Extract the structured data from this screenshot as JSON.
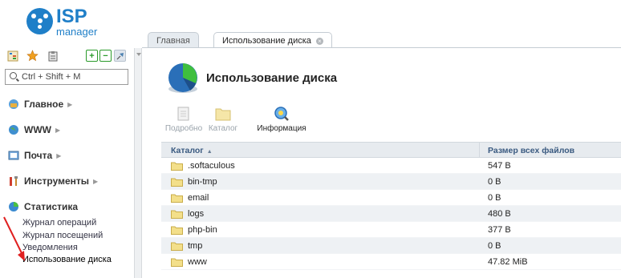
{
  "app": {
    "logo_text": "ISP",
    "logo_sub": "manager"
  },
  "search": {
    "placeholder": "Ctrl + Shift + M"
  },
  "left_toolbar": [
    {
      "icon": "tree-icon"
    },
    {
      "icon": "star-icon"
    },
    {
      "icon": "clipboard-icon"
    },
    {
      "icon": "expand-icon",
      "glyph": "+"
    },
    {
      "icon": "collapse-icon",
      "glyph": "−"
    },
    {
      "icon": "pin-icon"
    }
  ],
  "menu": {
    "groups": [
      {
        "label": "Главное",
        "icon": "home-icon"
      },
      {
        "label": "WWW",
        "icon": "globe-icon"
      },
      {
        "label": "Почта",
        "icon": "mail-icon"
      },
      {
        "label": "Инструменты",
        "icon": "tools-icon"
      },
      {
        "label": "Статистика",
        "icon": "stats-icon"
      }
    ],
    "stats_items": [
      {
        "label": "Журнал операций"
      },
      {
        "label": "Журнал посещений"
      },
      {
        "label": "Уведомления"
      },
      {
        "label": "Использование диска"
      }
    ]
  },
  "tabs": [
    {
      "label": "Главная",
      "active": false
    },
    {
      "label": "Использование диска",
      "active": true,
      "close": "×"
    }
  ],
  "page": {
    "title": "Использование диска"
  },
  "actions": [
    {
      "label": "Подробно",
      "icon": "details-icon",
      "enabled": false
    },
    {
      "label": "Каталог",
      "icon": "folder-icon",
      "enabled": false
    },
    {
      "label": "Информация",
      "icon": "info-icon",
      "enabled": true
    }
  ],
  "grid": {
    "columns": {
      "name": "Каталог",
      "size": "Размер всех файлов",
      "sort": "▲"
    },
    "rows": [
      {
        "name": ".softaculous",
        "size": "547 B"
      },
      {
        "name": "bin-tmp",
        "size": "0 B"
      },
      {
        "name": "email",
        "size": "0 B"
      },
      {
        "name": "logs",
        "size": "480 B"
      },
      {
        "name": "php-bin",
        "size": "377 B"
      },
      {
        "name": "tmp",
        "size": "0 B"
      },
      {
        "name": "www",
        "size": "47.82 MiB"
      }
    ]
  },
  "colors": {
    "brand": "#1f7fc8",
    "header_text": "#3a5a80",
    "row_alt": "#eef1f4",
    "annotation": "#e02020"
  }
}
